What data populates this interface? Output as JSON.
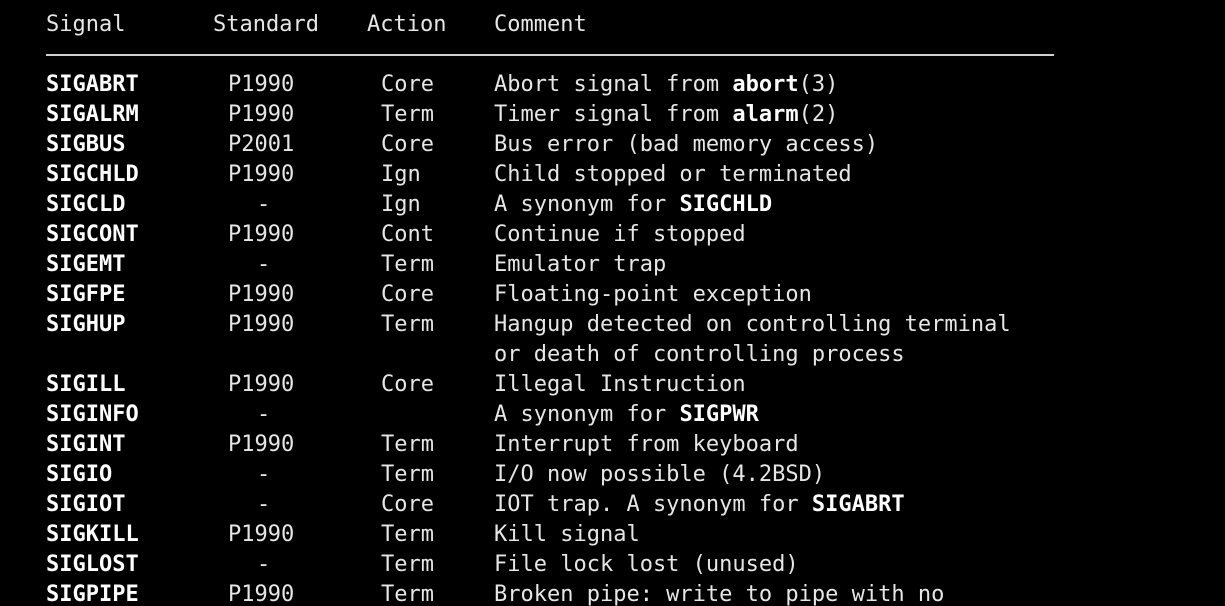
{
  "header": {
    "signal": "Signal",
    "standard": "Standard",
    "action": "Action",
    "comment": "Comment"
  },
  "rows": [
    {
      "signal": "SIGABRT",
      "standard": "P1990",
      "action": "Core",
      "comment": [
        {
          "t": "Abort signal from "
        },
        {
          "t": "abort",
          "b": true
        },
        {
          "t": "(3)"
        }
      ]
    },
    {
      "signal": "SIGALRM",
      "standard": "P1990",
      "action": "Term",
      "comment": [
        {
          "t": "Timer signal from "
        },
        {
          "t": "alarm",
          "b": true
        },
        {
          "t": "(2)"
        }
      ]
    },
    {
      "signal": "SIGBUS",
      "standard": "P2001",
      "action": "Core",
      "comment": [
        {
          "t": "Bus error (bad memory access)"
        }
      ]
    },
    {
      "signal": "SIGCHLD",
      "standard": "P1990",
      "action": "Ign",
      "comment": [
        {
          "t": "Child stopped or terminated"
        }
      ]
    },
    {
      "signal": "SIGCLD",
      "standard": "-",
      "action": "Ign",
      "comment": [
        {
          "t": "A synonym for "
        },
        {
          "t": "SIGCHLD",
          "b": true
        }
      ]
    },
    {
      "signal": "SIGCONT",
      "standard": "P1990",
      "action": "Cont",
      "comment": [
        {
          "t": "Continue if stopped"
        }
      ]
    },
    {
      "signal": "SIGEMT",
      "standard": "-",
      "action": "Term",
      "comment": [
        {
          "t": "Emulator trap"
        }
      ]
    },
    {
      "signal": "SIGFPE",
      "standard": "P1990",
      "action": "Core",
      "comment": [
        {
          "t": "Floating-point exception"
        }
      ]
    },
    {
      "signal": "SIGHUP",
      "standard": "P1990",
      "action": "Term",
      "comment": [
        {
          "t": "Hangup detected on controlling terminal"
        }
      ]
    },
    {
      "signal": "",
      "standard": "",
      "action": "",
      "comment": [
        {
          "t": "or death of controlling process"
        }
      ]
    },
    {
      "signal": "SIGILL",
      "standard": "P1990",
      "action": "Core",
      "comment": [
        {
          "t": "Illegal Instruction"
        }
      ]
    },
    {
      "signal": "SIGINFO",
      "standard": "-",
      "action": "",
      "comment": [
        {
          "t": "A synonym for "
        },
        {
          "t": "SIGPWR",
          "b": true
        }
      ]
    },
    {
      "signal": "SIGINT",
      "standard": "P1990",
      "action": "Term",
      "comment": [
        {
          "t": "Interrupt from keyboard"
        }
      ]
    },
    {
      "signal": "SIGIO",
      "standard": "-",
      "action": "Term",
      "comment": [
        {
          "t": "I/O now possible (4.2BSD)"
        }
      ]
    },
    {
      "signal": "SIGIOT",
      "standard": "-",
      "action": "Core",
      "comment": [
        {
          "t": "IOT trap. A synonym for "
        },
        {
          "t": "SIGABRT",
          "b": true
        }
      ]
    },
    {
      "signal": "SIGKILL",
      "standard": "P1990",
      "action": "Term",
      "comment": [
        {
          "t": "Kill signal"
        }
      ]
    },
    {
      "signal": "SIGLOST",
      "standard": "-",
      "action": "Term",
      "comment": [
        {
          "t": "File lock lost (unused)"
        }
      ]
    },
    {
      "signal": "SIGPIPE",
      "standard": "P1990",
      "action": "Term",
      "comment": [
        {
          "t": "Broken pipe: write to pipe with no"
        }
      ]
    }
  ]
}
